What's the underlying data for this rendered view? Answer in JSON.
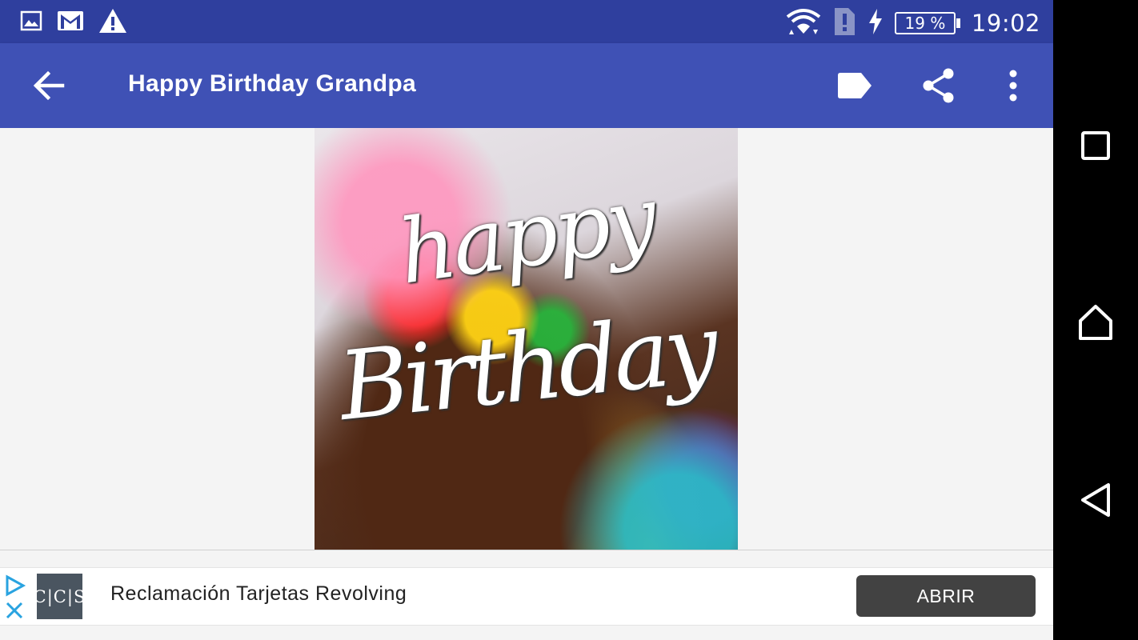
{
  "status_bar": {
    "time": "19:02",
    "battery_percent": "19 %",
    "icons": [
      "image-icon",
      "gmail-icon",
      "warning-icon",
      "wifi-icon",
      "sim-alert-icon",
      "charging-icon",
      "battery-icon"
    ]
  },
  "app_bar": {
    "title": "Happy Birthday Grandpa",
    "actions": [
      "label-icon",
      "share-icon",
      "more-vert-icon"
    ],
    "color": "#3f51b5",
    "status_color": "#2f3f9e"
  },
  "card": {
    "line1": "happy",
    "line2": "Birthday"
  },
  "ad": {
    "logo_text": "C|C|S",
    "text": "Reclamación Tarjetas Revolving",
    "button_label": "ABRIR",
    "accent": "#29a3e0"
  },
  "nav_bar": {
    "buttons": [
      "recents-icon",
      "home-icon",
      "back-icon"
    ]
  }
}
